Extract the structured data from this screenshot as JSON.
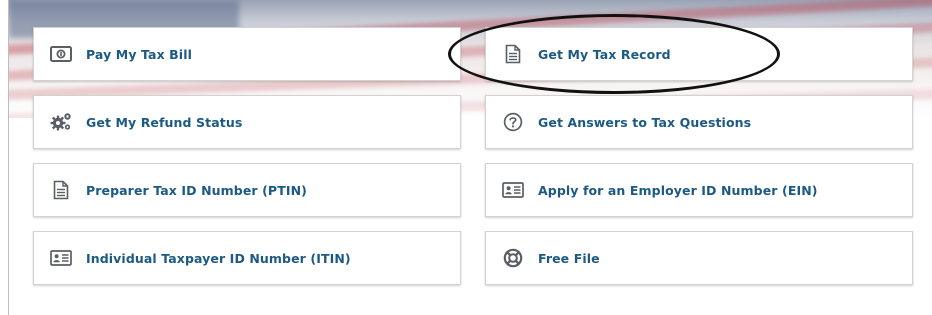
{
  "services": [
    {
      "key": "pay-my-tax-bill",
      "label": "Pay My Tax Bill",
      "icon": "money-bill-icon"
    },
    {
      "key": "get-my-tax-record",
      "label": "Get My Tax Record",
      "icon": "document-icon"
    },
    {
      "key": "get-my-refund-status",
      "label": "Get My Refund Status",
      "icon": "gears-icon"
    },
    {
      "key": "get-answers-to-tax-questions",
      "label": "Get Answers to Tax Questions",
      "icon": "question-circle-icon"
    },
    {
      "key": "preparer-tax-id-number",
      "label": "Preparer Tax ID Number (PTIN)",
      "icon": "document-icon"
    },
    {
      "key": "apply-employer-id-number",
      "label": "Apply for an Employer ID Number (EIN)",
      "icon": "id-card-icon"
    },
    {
      "key": "individual-taxpayer-id-number",
      "label": "Individual Taxpayer ID Number (ITIN)",
      "icon": "id-card-icon"
    },
    {
      "key": "free-file",
      "label": "Free File",
      "icon": "life-ring-icon"
    }
  ],
  "colors": {
    "link": "#1c5a84",
    "icon": "#5a5f66",
    "annotation": "#111111"
  }
}
